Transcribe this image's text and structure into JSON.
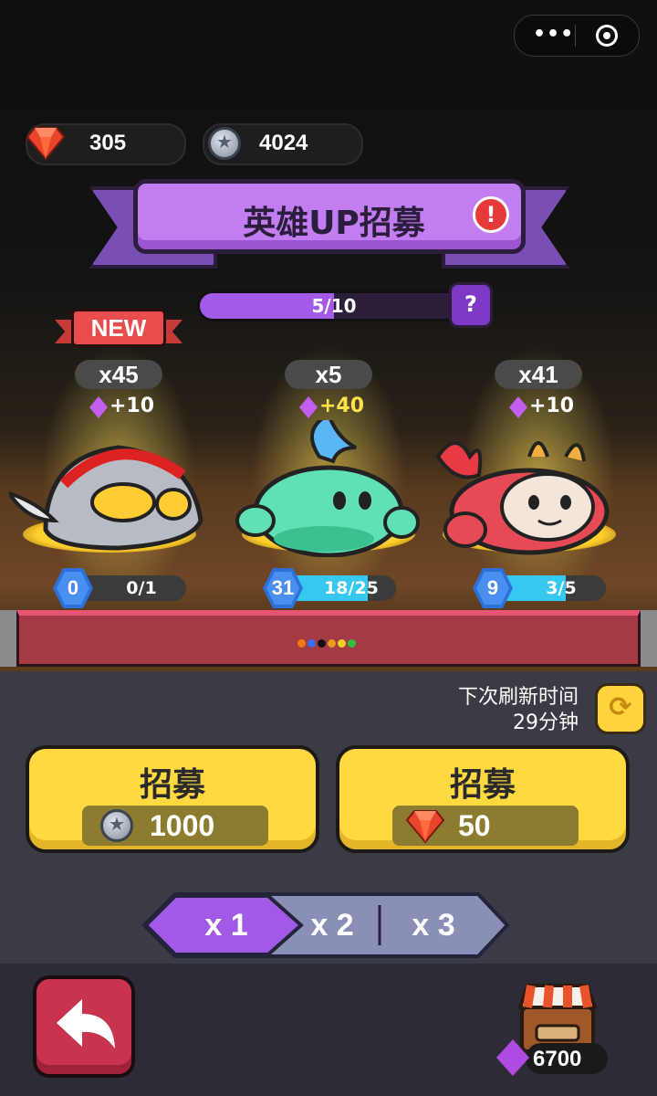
{
  "menu_capsule": {
    "more_icon": "more-dots-icon",
    "close_icon": "target-icon"
  },
  "currency": {
    "gems": "305",
    "coins": "4024"
  },
  "banner": {
    "title": "英雄UP招募",
    "alert": "!"
  },
  "progress": {
    "label": "5/10",
    "current": 5,
    "max": 10,
    "help": "?"
  },
  "new_tag": "NEW",
  "heroes": [
    {
      "count": "x45",
      "bonus": "+10",
      "level": "0",
      "progress": "0/1",
      "progress_fraction": 0.0,
      "name_icon": "ultraman-hero-icon"
    },
    {
      "count": "x5",
      "bonus": "+40",
      "level": "31",
      "progress": "18/25",
      "progress_fraction": 0.72,
      "name_icon": "green-slime-hero-icon"
    },
    {
      "count": "x41",
      "bonus": "+10",
      "level": "9",
      "progress": "3/5",
      "progress_fraction": 0.6,
      "name_icon": "red-lion-hero-icon"
    }
  ],
  "colors": {
    "bonus_highlight": "#ffe24a",
    "bonus_normal": "#ffffff",
    "page_dots": [
      "#f07b10",
      "#3a6ef0",
      "#111111",
      "#e6a020",
      "#f0d020",
      "#30c040"
    ]
  },
  "refresh": {
    "line1": "下次刷新时间",
    "line2": "29分钟"
  },
  "recruit": [
    {
      "label": "招募",
      "price": "1000",
      "currency_icon": "coin-icon"
    },
    {
      "label": "招募",
      "price": "50",
      "currency_icon": "gem-icon"
    }
  ],
  "multipliers": [
    "x 1",
    "x 2",
    "x 3"
  ],
  "shop": {
    "value": "6700"
  }
}
